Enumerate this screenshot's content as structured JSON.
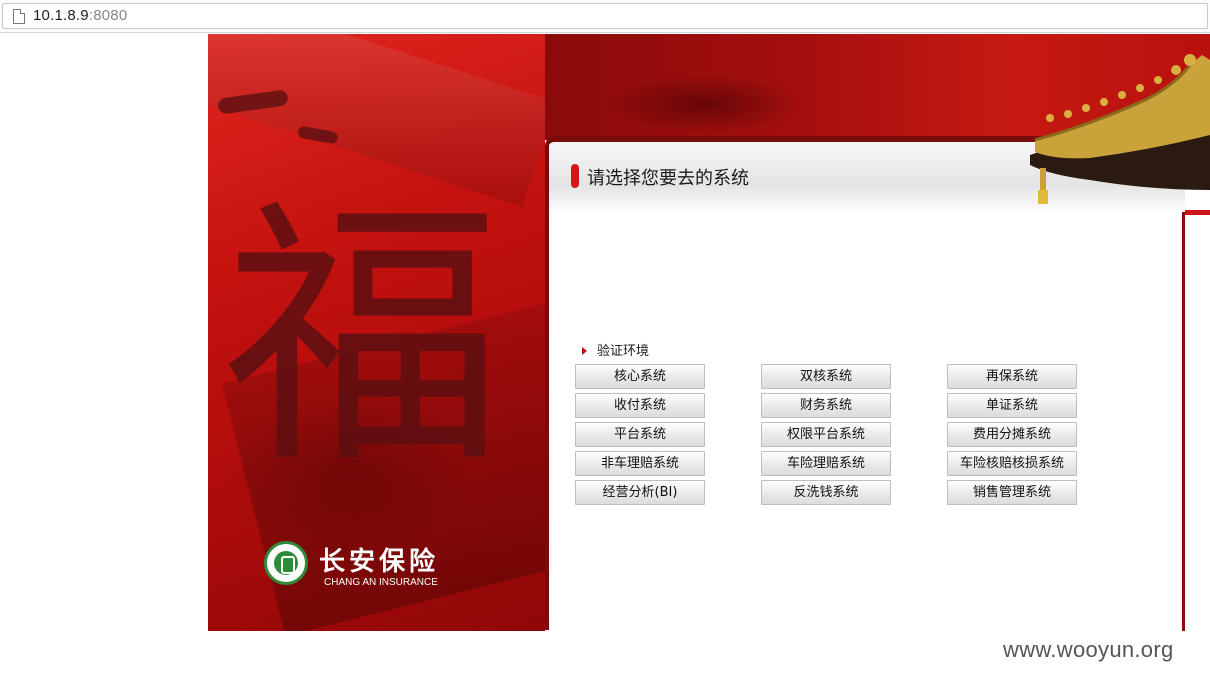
{
  "browser": {
    "url_host": "10.1.8.9",
    "url_port": ":8080"
  },
  "banner": {
    "calligraphy_char": "福",
    "logo_cn": "长安保险",
    "logo_en": "CHANG AN INSURANCE"
  },
  "panel": {
    "title": "请选择您要去的系统",
    "section_label": "验证环境",
    "buttons": [
      [
        "核心系统",
        "双核系统",
        "再保系统"
      ],
      [
        "收付系统",
        "财务系统",
        "单证系统"
      ],
      [
        "平台系统",
        "权限平台系统",
        "费用分摊系统"
      ],
      [
        "非车理赔系统",
        "车险理赔系统",
        "车险核赔核损系统"
      ],
      [
        "经营分析(BI)",
        "反洗钱系统",
        "销售管理系统"
      ]
    ]
  },
  "watermark": "www.wooyun.org",
  "colors": {
    "brand_red": "#c4120f",
    "dark_red": "#7a0b0b",
    "logo_green": "#2e8b3a"
  }
}
